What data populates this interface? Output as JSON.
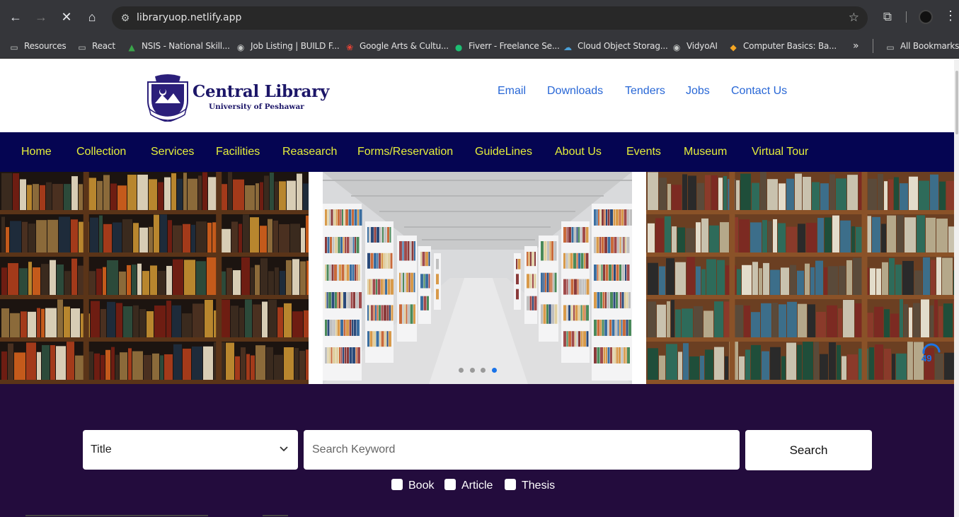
{
  "browser": {
    "url": "libraryuop.netlify.app",
    "bookmarks": [
      {
        "label": "Resources",
        "icon": "folder-icon"
      },
      {
        "label": "React",
        "icon": "folder-icon"
      },
      {
        "label": "NSIS - National Skill...",
        "icon": "nsis-icon"
      },
      {
        "label": "Job Listing | BUILD F...",
        "icon": "globe-icon"
      },
      {
        "label": "Google Arts & Cultu...",
        "icon": "google-arts-icon"
      },
      {
        "label": "Fiverr - Freelance Se...",
        "icon": "fiverr-icon"
      },
      {
        "label": "Cloud Object Storag...",
        "icon": "cloud-icon"
      },
      {
        "label": "VidyoAI",
        "icon": "globe-icon"
      },
      {
        "label": "Computer Basics: Ba...",
        "icon": "gcf-icon"
      }
    ],
    "overflow": "»",
    "all_bookmarks": "All Bookmarks"
  },
  "header": {
    "logo_title": "Central Library",
    "logo_subtitle": "University of Peshawar",
    "links": [
      "Email",
      "Downloads",
      "Tenders",
      "Jobs",
      "Contact Us"
    ]
  },
  "nav": {
    "items": [
      "Home",
      "Collection",
      "Services",
      "Facilities",
      "Reasearch",
      "Forms/Reservation",
      "GuideLines",
      "About Us",
      "Events",
      "Museum",
      "Virtual Tour"
    ]
  },
  "carousel": {
    "slide_count": 4,
    "active_slide": 4,
    "loader_text": "49"
  },
  "search": {
    "field_select": "Title",
    "placeholder": "Search Keyword",
    "button": "Search",
    "filters": [
      "Book",
      "Article",
      "Thesis"
    ]
  },
  "colors": {
    "nav_bg": "#050552",
    "nav_text": "#e6ef3a",
    "link": "#2867d6",
    "search_bg": "#230c3d"
  }
}
